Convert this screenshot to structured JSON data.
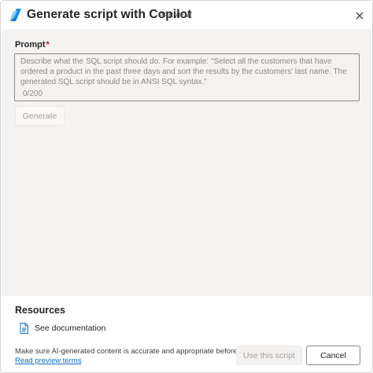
{
  "dialog": {
    "title": "Generate script with Copilot",
    "badge": "PREVIEW",
    "icons": {
      "app": "copilot-icon",
      "close": "close-icon"
    }
  },
  "prompt": {
    "label": "Prompt",
    "required_marker": "*",
    "placeholder": "Describe what the SQL script should do. For example: \"Select all the customers that have ordered a product in the past three days and sort the results by the customers' last name. The generated SQL script should be in ANSI SQL syntax.\"",
    "value": "",
    "char_count": "0/200"
  },
  "actions": {
    "generate_label": "Generate",
    "use_script_label": "Use this script",
    "cancel_label": "Cancel"
  },
  "resources": {
    "title": "Resources",
    "links": [
      {
        "label": "See documentation",
        "icon": "document-icon"
      }
    ]
  },
  "footer": {
    "disclaimer": "Make sure AI-generated content is accurate and appropriate before using.",
    "terms_link": "Read preview terms"
  },
  "colors": {
    "panel_bg": "#f5f3f2",
    "link": "#0f6cbd",
    "required": "#c50f1f",
    "disabled_text": "#a19f9d"
  }
}
